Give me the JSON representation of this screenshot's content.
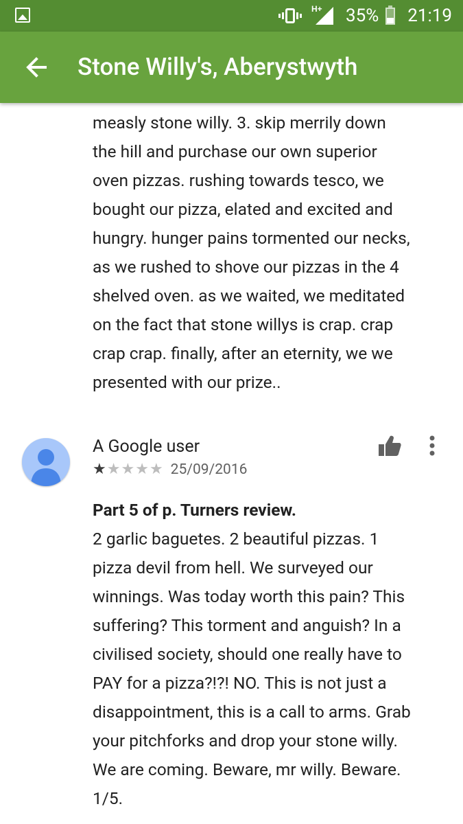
{
  "status_bar": {
    "battery_percent": "35%",
    "battery_level": 0.35,
    "time": "21:19",
    "network_label": "H+",
    "icons": [
      "gallery-icon",
      "vibrate-icon",
      "signal-icon",
      "battery-icon"
    ]
  },
  "app_bar": {
    "title": "Stone Willy's, Aberystwyth",
    "back_icon": "arrow-back-icon",
    "color": "#68a33e",
    "status_color": "#548d32"
  },
  "review_1": {
    "lines": [
      "measly stone willy. 3. skip merrily down",
      "the hill and purchase our own superior",
      "oven pizzas. rushing towards tesco, we",
      "bought our pizza, elated and excited and",
      "hungry. hunger pains tormented our necks,",
      "as we rushed to shove our pizzas in the 4",
      "shelved oven. as we waited, we meditated",
      "on the fact that stone willys is crap. crap",
      "crap crap. finally, after an eternity, we we",
      "presented with our prize.."
    ]
  },
  "review_2": {
    "author": "A Google user",
    "rating": 1,
    "max_rating": 5,
    "date": "25/09/2016",
    "title": "Part 5 of p. Turners review.",
    "lines": [
      "2 garlic baguetes. 2 beautiful pizzas. 1",
      "pizza devil from hell. We surveyed our",
      "winnings. Was today worth this pain? This",
      "suffering? This torment and anguish? In a",
      "civilised society, should one really have to",
      "PAY for a pizza?!?! NO. This is not just a",
      "disappointment, this is a call to arms. Grab",
      "your pitchforks and drop your stone willy.",
      "We are coming. Beware, mr willy. Beware.",
      "1/5."
    ],
    "icons": [
      "avatar-person-icon",
      "thumbs-up-icon",
      "more-vert-icon"
    ]
  }
}
